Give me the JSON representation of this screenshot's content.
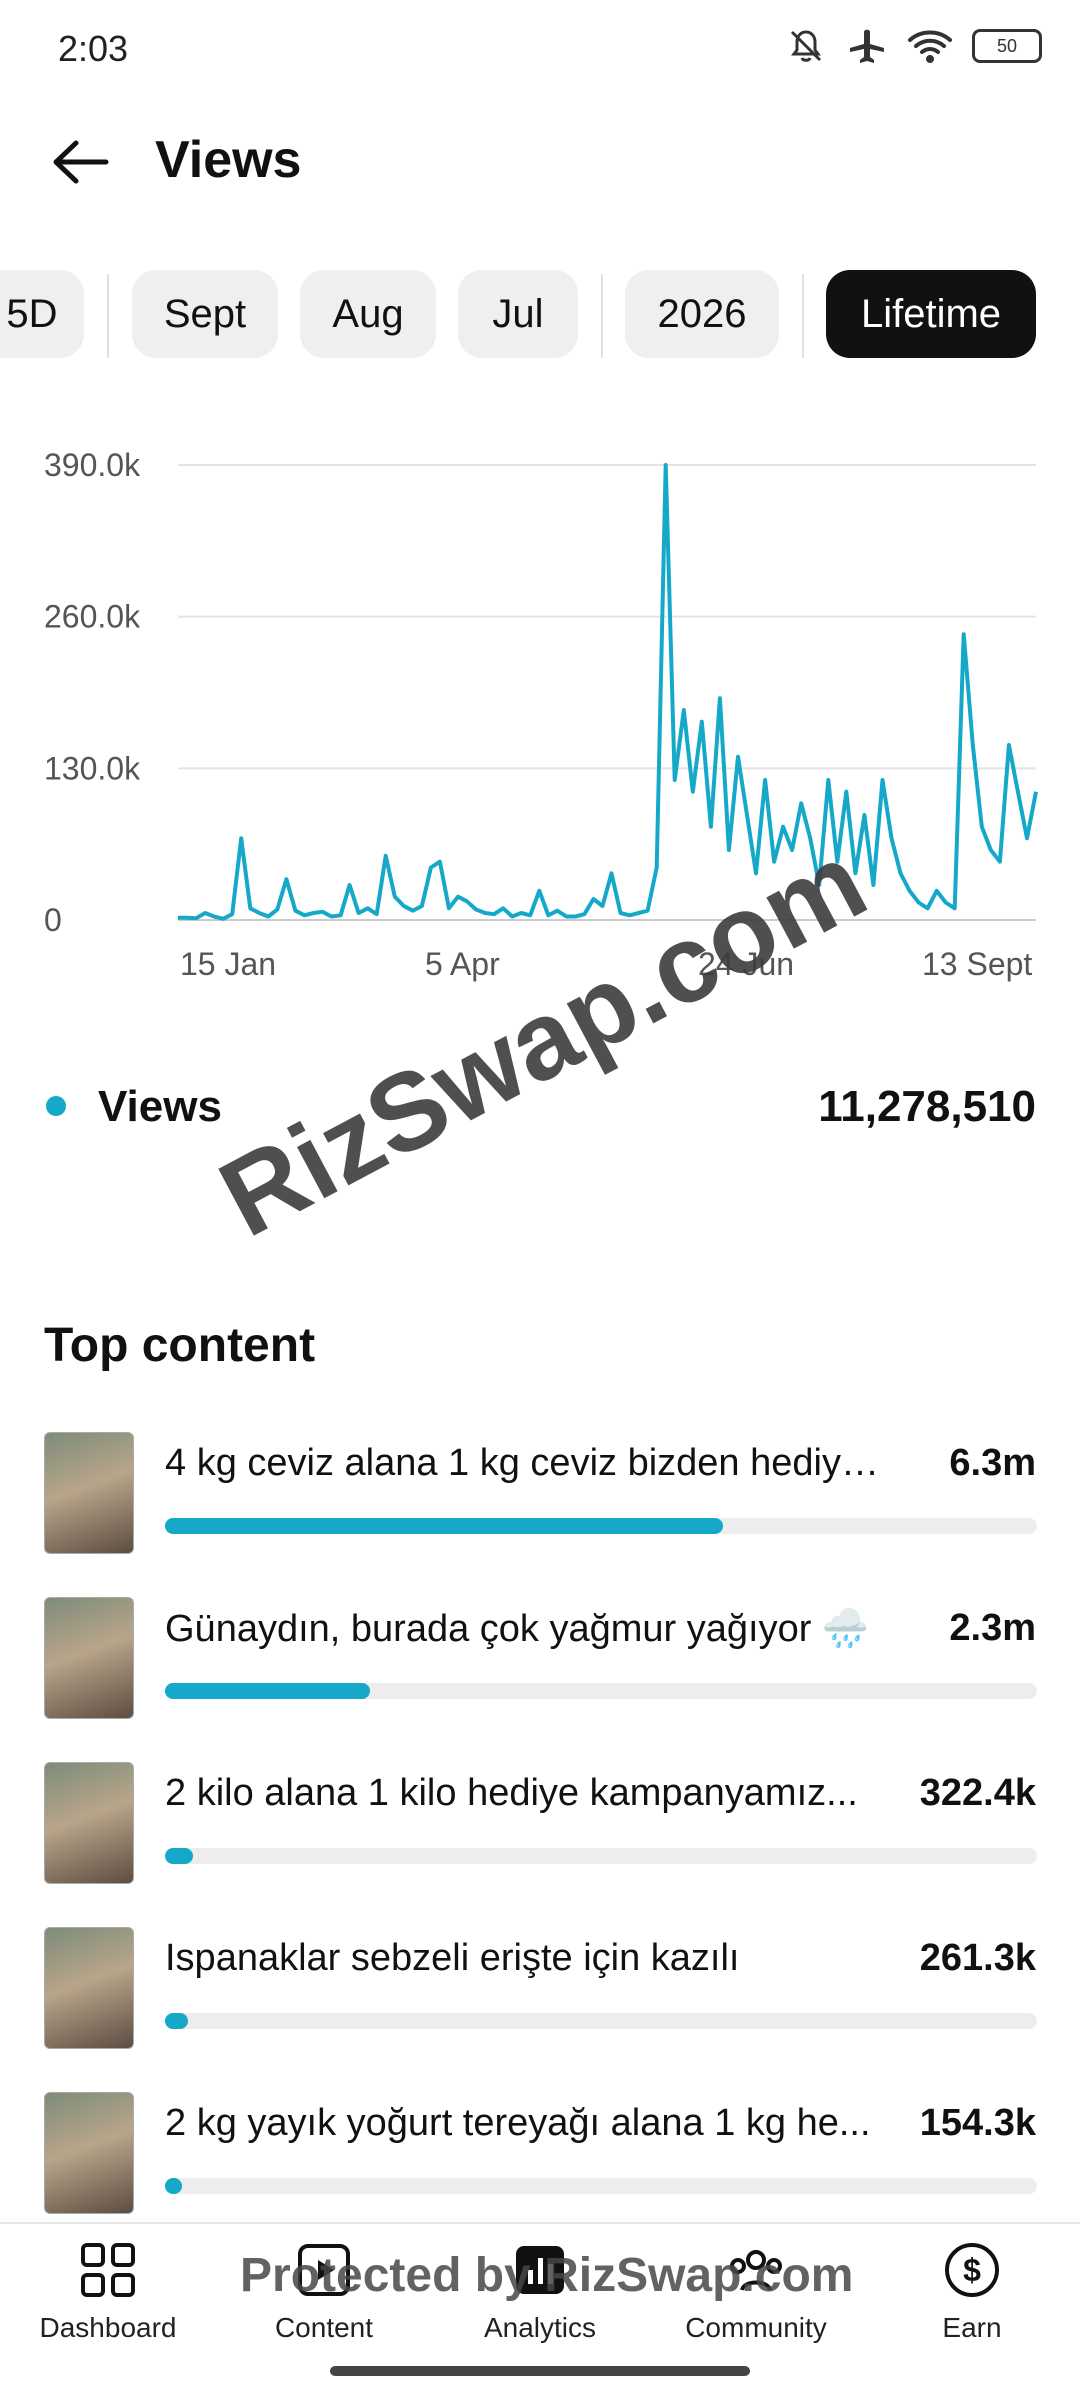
{
  "status": {
    "time": "2:03",
    "battery": "50"
  },
  "header": {
    "title": "Views"
  },
  "filters": [
    {
      "label": "5D",
      "active": false
    },
    {
      "label": "Sept",
      "active": false
    },
    {
      "label": "Aug",
      "active": false
    },
    {
      "label": "Jul",
      "active": false
    },
    {
      "label": "2026",
      "active": false
    },
    {
      "label": "Lifetime",
      "active": true
    }
  ],
  "chart_data": {
    "type": "line",
    "series": [
      {
        "name": "Views",
        "color": "#16a8c9",
        "values": [
          2000,
          2000,
          1500,
          6000,
          3000,
          1000,
          5000,
          70000,
          10000,
          6000,
          3000,
          9000,
          35000,
          8000,
          4000,
          6000,
          7000,
          3000,
          4000,
          30000,
          6000,
          10000,
          5000,
          55000,
          20000,
          12000,
          8000,
          12000,
          45000,
          50000,
          10000,
          20000,
          16000,
          9000,
          6000,
          5000,
          10000,
          3000,
          6000,
          4000,
          25000,
          4000,
          8000,
          3000,
          3000,
          5000,
          18000,
          12000,
          40000,
          6000,
          4000,
          6000,
          8000,
          45000,
          390000,
          120000,
          180000,
          110000,
          170000,
          80000,
          190000,
          60000,
          140000,
          90000,
          40000,
          120000,
          50000,
          80000,
          60000,
          100000,
          70000,
          30000,
          120000,
          50000,
          110000,
          40000,
          90000,
          30000,
          120000,
          70000,
          40000,
          25000,
          15000,
          10000,
          25000,
          15000,
          10000,
          245000,
          150000,
          80000,
          60000,
          50000,
          150000,
          110000,
          70000,
          110000
        ]
      }
    ],
    "x_tick_labels": [
      "15 Jan",
      "5 Apr",
      "24 Jun",
      "13 Sept"
    ],
    "y_tick_labels": [
      "0",
      "130.0k",
      "260.0k",
      "390.0k"
    ],
    "ylim": [
      0,
      390000
    ]
  },
  "legend": {
    "label": "Views",
    "value": "11,278,510"
  },
  "top_content": {
    "title": "Top content",
    "items": [
      {
        "title": "4 kg ceviz alana 1 kg ceviz bizden hediye...",
        "value": "6.3m",
        "fraction": 0.64
      },
      {
        "title": "Günaydın, burada çok yağmur yağıyor 🌧️",
        "value": "2.3m",
        "fraction": 0.235
      },
      {
        "title": "2 kilo alana 1 kilo hediye kampanyamız...",
        "value": "322.4k",
        "fraction": 0.032
      },
      {
        "title": "Ispanaklar sebzeli erişte için kazılı",
        "value": "261.3k",
        "fraction": 0.026
      },
      {
        "title": "2 kg yayık yoğurt tereyağı alana 1 kg he...",
        "value": "154.3k",
        "fraction": 0.02
      }
    ]
  },
  "watermark": {
    "main": "RizSwap.com",
    "nav": "Protected by RizSwap.com"
  },
  "nav": [
    {
      "label": "Dashboard",
      "icon": "dashboard-icon"
    },
    {
      "label": "Content",
      "icon": "content-icon"
    },
    {
      "label": "Analytics",
      "icon": "analytics-icon"
    },
    {
      "label": "Community",
      "icon": "community-icon"
    },
    {
      "label": "Earn",
      "icon": "earn-dollar-icon"
    }
  ]
}
